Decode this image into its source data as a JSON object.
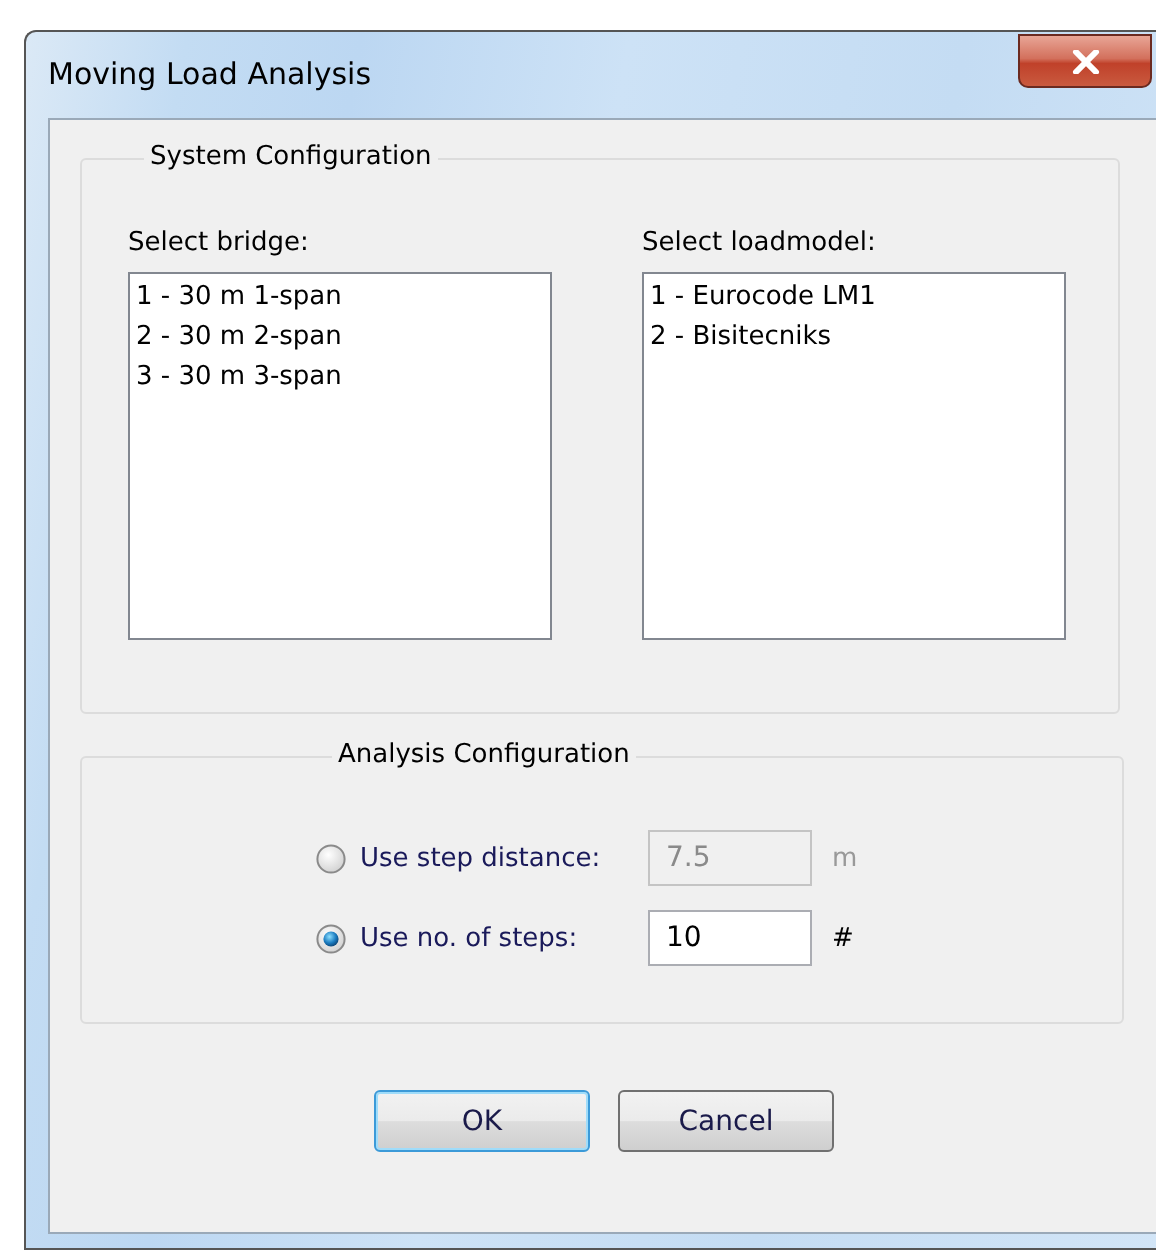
{
  "window": {
    "title": "Moving Load Analysis"
  },
  "system_configuration": {
    "title": "System Configuration",
    "lists": [
      {
        "label": "Select bridge:",
        "items": [
          "1 - 30 m 1-span",
          "2 - 30 m 2-span",
          "3 - 30 m 3-span"
        ]
      },
      {
        "label": "Select loadmodel:",
        "items": [
          "1 - Eurocode LM1",
          "2 - Bisitecniks"
        ]
      }
    ]
  },
  "analysis_configuration": {
    "title": "Analysis Configuration",
    "options": [
      {
        "label": "Use step distance:",
        "selected": false,
        "value": "7.5",
        "disabled": true,
        "unit": "m"
      },
      {
        "label": "Use no. of steps:",
        "selected": true,
        "value": "10",
        "disabled": false,
        "unit": "#"
      }
    ]
  },
  "buttons": [
    {
      "label": "OK",
      "default": true
    },
    {
      "label": "Cancel",
      "default": false
    }
  ]
}
